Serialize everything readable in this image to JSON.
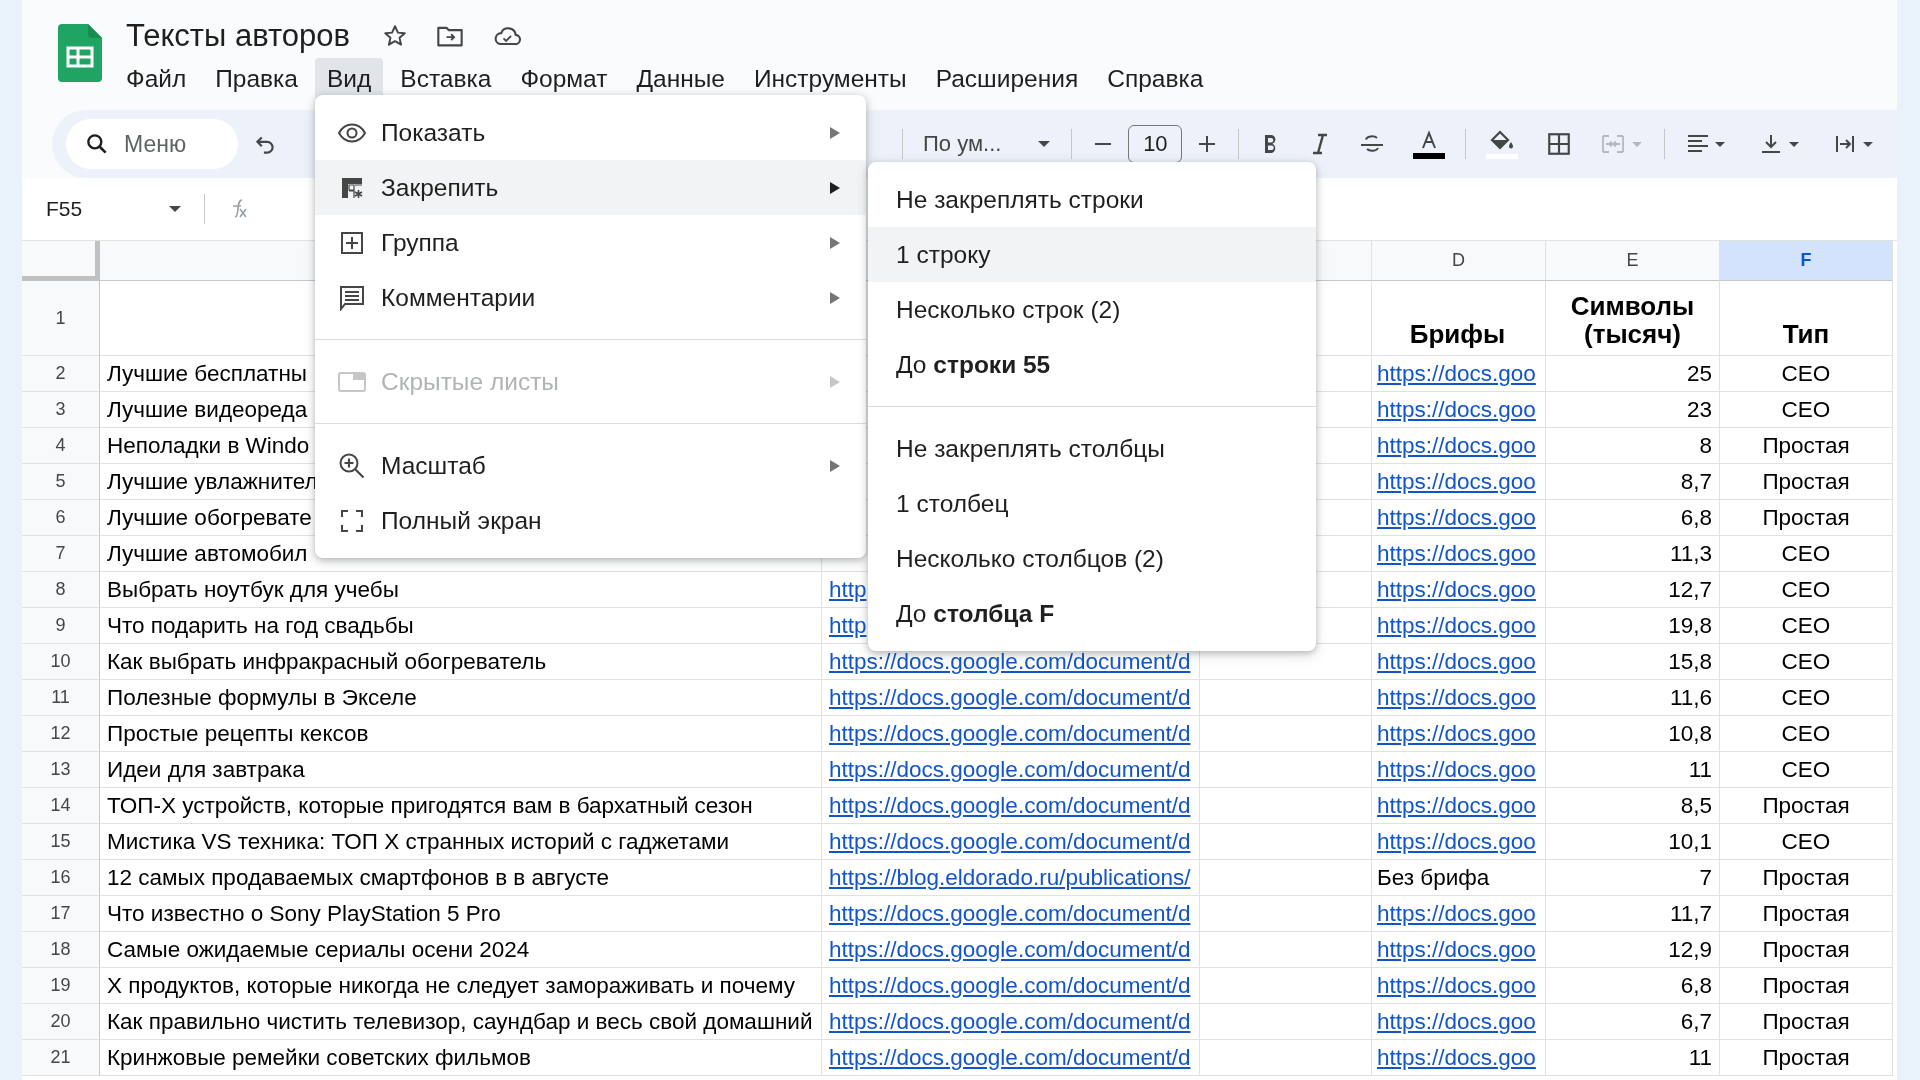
{
  "document": {
    "title": "Тексты авторов"
  },
  "menu_bar": [
    {
      "label": "Файл",
      "selected": false
    },
    {
      "label": "Правка",
      "selected": false
    },
    {
      "label": "Вид",
      "selected": true
    },
    {
      "label": "Вставка",
      "selected": false
    },
    {
      "label": "Формат",
      "selected": false
    },
    {
      "label": "Данные",
      "selected": false
    },
    {
      "label": "Инструменты",
      "selected": false
    },
    {
      "label": "Расширения",
      "selected": false
    },
    {
      "label": "Справка",
      "selected": false
    }
  ],
  "toolbar": {
    "search": {
      "placeholder": "Меню"
    },
    "font": "По ум...",
    "font_size": "10"
  },
  "formula_bar": {
    "cell_ref": "F55"
  },
  "columns": [
    {},
    {},
    {},
    {
      "label": "D",
      "selected": false
    },
    {
      "label": "E",
      "selected": false
    },
    {
      "label": "F",
      "selected": true
    }
  ],
  "rows": [
    {
      "number": "1",
      "cells": [
        {
          "kind": "empty"
        },
        {
          "kind": "empty"
        },
        {
          "kind": "empty"
        },
        {
          "kind": "header",
          "text": "Брифы"
        },
        {
          "kind": "header",
          "text": "Символы (тысяч)"
        },
        {
          "kind": "header",
          "text": "Тип"
        }
      ]
    },
    {
      "number": "2",
      "cells": [
        {
          "kind": "text",
          "text": "Лучшие бесплатны"
        },
        {
          "kind": "empty"
        },
        {
          "kind": "empty"
        },
        {
          "kind": "link",
          "text": "https://docs.goo"
        },
        {
          "kind": "text",
          "text": "25"
        },
        {
          "kind": "text",
          "text": "СЕО"
        }
      ]
    },
    {
      "number": "3",
      "cells": [
        {
          "kind": "text",
          "text": "Лучшие видеореда"
        },
        {
          "kind": "empty"
        },
        {
          "kind": "empty"
        },
        {
          "kind": "link",
          "text": "https://docs.goo"
        },
        {
          "kind": "text",
          "text": "23"
        },
        {
          "kind": "text",
          "text": "СЕО"
        }
      ]
    },
    {
      "number": "4",
      "cells": [
        {
          "kind": "text",
          "text": "Неполадки в Windo"
        },
        {
          "kind": "empty"
        },
        {
          "kind": "empty"
        },
        {
          "kind": "link",
          "text": "https://docs.goo"
        },
        {
          "kind": "text",
          "text": "8"
        },
        {
          "kind": "text",
          "text": "Простая"
        }
      ]
    },
    {
      "number": "5",
      "cells": [
        {
          "kind": "text",
          "text": "Лучшие увлажнител"
        },
        {
          "kind": "empty"
        },
        {
          "kind": "empty"
        },
        {
          "kind": "link",
          "text": "https://docs.goo"
        },
        {
          "kind": "text",
          "text": "8,7"
        },
        {
          "kind": "text",
          "text": "Простая"
        }
      ]
    },
    {
      "number": "6",
      "cells": [
        {
          "kind": "text",
          "text": "Лучшие обогревате"
        },
        {
          "kind": "empty"
        },
        {
          "kind": "empty"
        },
        {
          "kind": "link",
          "text": "https://docs.goo"
        },
        {
          "kind": "text",
          "text": "6,8"
        },
        {
          "kind": "text",
          "text": "Простая"
        }
      ]
    },
    {
      "number": "7",
      "cells": [
        {
          "kind": "text",
          "text": "Лучшие автомобил"
        },
        {
          "kind": "empty"
        },
        {
          "kind": "empty"
        },
        {
          "kind": "link",
          "text": "https://docs.goo"
        },
        {
          "kind": "text",
          "text": "11,3"
        },
        {
          "kind": "text",
          "text": "СЕО"
        }
      ]
    },
    {
      "number": "8",
      "cells": [
        {
          "kind": "text",
          "text": "Выбрать ноутбук для учебы"
        },
        {
          "kind": "link",
          "text": "http"
        },
        {
          "kind": "empty"
        },
        {
          "kind": "link",
          "text": "https://docs.goo"
        },
        {
          "kind": "text",
          "text": "12,7"
        },
        {
          "kind": "text",
          "text": "СЕО"
        }
      ]
    },
    {
      "number": "9",
      "cells": [
        {
          "kind": "text",
          "text": "Что подарить на год свадьбы"
        },
        {
          "kind": "link",
          "text": "http"
        },
        {
          "kind": "empty"
        },
        {
          "kind": "link",
          "text": "https://docs.goo"
        },
        {
          "kind": "text",
          "text": "19,8"
        },
        {
          "kind": "text",
          "text": "СЕО"
        }
      ]
    },
    {
      "number": "10",
      "cells": [
        {
          "kind": "text",
          "text": "Как выбрать инфракрасный обогреватель"
        },
        {
          "kind": "link",
          "text": "https://docs.google.com/document/d"
        },
        {
          "kind": "empty"
        },
        {
          "kind": "link",
          "text": "https://docs.goo"
        },
        {
          "kind": "text",
          "text": "15,8"
        },
        {
          "kind": "text",
          "text": "СЕО"
        }
      ]
    },
    {
      "number": "11",
      "cells": [
        {
          "kind": "text",
          "text": "Полезные формулы в Экселе"
        },
        {
          "kind": "link",
          "text": "https://docs.google.com/document/d"
        },
        {
          "kind": "empty"
        },
        {
          "kind": "link",
          "text": "https://docs.goo"
        },
        {
          "kind": "text",
          "text": "11,6"
        },
        {
          "kind": "text",
          "text": "СЕО"
        }
      ]
    },
    {
      "number": "12",
      "cells": [
        {
          "kind": "text",
          "text": "Простые рецепты кексов"
        },
        {
          "kind": "link",
          "text": "https://docs.google.com/document/d"
        },
        {
          "kind": "empty"
        },
        {
          "kind": "link",
          "text": "https://docs.goo"
        },
        {
          "kind": "text",
          "text": "10,8"
        },
        {
          "kind": "text",
          "text": "СЕО"
        }
      ]
    },
    {
      "number": "13",
      "cells": [
        {
          "kind": "text",
          "text": "Идеи для завтрака"
        },
        {
          "kind": "link",
          "text": "https://docs.google.com/document/d"
        },
        {
          "kind": "empty"
        },
        {
          "kind": "link",
          "text": "https://docs.goo"
        },
        {
          "kind": "text",
          "text": "11"
        },
        {
          "kind": "text",
          "text": "СЕО"
        }
      ]
    },
    {
      "number": "14",
      "cells": [
        {
          "kind": "text",
          "text": "ТОП-Х устройств, которые пригодятся вам в бархатный сезон"
        },
        {
          "kind": "link",
          "text": "https://docs.google.com/document/d"
        },
        {
          "kind": "empty"
        },
        {
          "kind": "link",
          "text": "https://docs.goo"
        },
        {
          "kind": "text",
          "text": "8,5"
        },
        {
          "kind": "text",
          "text": "Простая"
        }
      ]
    },
    {
      "number": "15",
      "cells": [
        {
          "kind": "text",
          "text": "Мистика VS техника: ТОП Х странных историй с гаджетами"
        },
        {
          "kind": "link",
          "text": "https://docs.google.com/document/d"
        },
        {
          "kind": "empty"
        },
        {
          "kind": "link",
          "text": "https://docs.goo"
        },
        {
          "kind": "text",
          "text": "10,1"
        },
        {
          "kind": "text",
          "text": "СЕО"
        }
      ]
    },
    {
      "number": "16",
      "cells": [
        {
          "kind": "text",
          "text": "12 самых продаваемых смартфонов в в августе"
        },
        {
          "kind": "link",
          "text": "https://blog.eldorado.ru/publications/"
        },
        {
          "kind": "empty"
        },
        {
          "kind": "text",
          "text": "Без брифа"
        },
        {
          "kind": "text",
          "text": "7"
        },
        {
          "kind": "text",
          "text": "Простая"
        }
      ]
    },
    {
      "number": "17",
      "cells": [
        {
          "kind": "text",
          "text": "Что известно о Sony PlayStation 5 Pro"
        },
        {
          "kind": "link",
          "text": "https://docs.google.com/document/d"
        },
        {
          "kind": "empty"
        },
        {
          "kind": "link",
          "text": "https://docs.goo"
        },
        {
          "kind": "text",
          "text": "11,7"
        },
        {
          "kind": "text",
          "text": "Простая"
        }
      ]
    },
    {
      "number": "18",
      "cells": [
        {
          "kind": "text",
          "text": "Самые ожидаемые сериалы осени 2024"
        },
        {
          "kind": "link",
          "text": "https://docs.google.com/document/d"
        },
        {
          "kind": "empty"
        },
        {
          "kind": "link",
          "text": "https://docs.goo"
        },
        {
          "kind": "text",
          "text": "12,9"
        },
        {
          "kind": "text",
          "text": "Простая"
        }
      ]
    },
    {
      "number": "19",
      "cells": [
        {
          "kind": "text",
          "text": "Х продуктов, которые никогда не следует замораживать и почему"
        },
        {
          "kind": "link",
          "text": "https://docs.google.com/document/d"
        },
        {
          "kind": "empty"
        },
        {
          "kind": "link",
          "text": "https://docs.goo"
        },
        {
          "kind": "text",
          "text": "6,8"
        },
        {
          "kind": "text",
          "text": "Простая"
        }
      ]
    },
    {
      "number": "20",
      "cells": [
        {
          "kind": "text",
          "text": "Как правильно чистить телевизор, саундбар и весь свой домашний"
        },
        {
          "kind": "link",
          "text": "https://docs.google.com/document/d"
        },
        {
          "kind": "empty"
        },
        {
          "kind": "link",
          "text": "https://docs.goo"
        },
        {
          "kind": "text",
          "text": "6,7"
        },
        {
          "kind": "text",
          "text": "Простая"
        }
      ]
    },
    {
      "number": "21",
      "cells": [
        {
          "kind": "text",
          "text": "Кринжовые ремейки советских фильмов"
        },
        {
          "kind": "link",
          "text": "https://docs.google.com/document/d"
        },
        {
          "kind": "empty"
        },
        {
          "kind": "link",
          "text": "https://docs.goo"
        },
        {
          "kind": "text",
          "text": "11"
        },
        {
          "kind": "text",
          "text": "Простая"
        }
      ]
    }
  ],
  "view_menu": {
    "items": [
      {
        "kind": "item",
        "label": "Показать",
        "selected": false,
        "disabled": false,
        "submenu": true
      },
      {
        "kind": "item",
        "label": "Закрепить",
        "selected": true,
        "disabled": false,
        "submenu": true
      },
      {
        "kind": "item",
        "label": "Группа",
        "selected": false,
        "disabled": false,
        "submenu": true
      },
      {
        "kind": "item",
        "label": "Комментарии",
        "selected": false,
        "disabled": false,
        "submenu": true
      },
      {
        "kind": "divider"
      },
      {
        "kind": "item",
        "label": "Скрытые листы",
        "selected": false,
        "disabled": true,
        "submenu": true
      },
      {
        "kind": "divider"
      },
      {
        "kind": "item",
        "label": "Масштаб",
        "selected": false,
        "disabled": false,
        "submenu": true
      },
      {
        "kind": "item",
        "label": "Полный экран",
        "selected": false,
        "disabled": false,
        "submenu": false
      }
    ]
  },
  "freeze_submenu": {
    "items": [
      {
        "kind": "item",
        "label": "Не закреплять строки",
        "selected": false
      },
      {
        "kind": "item",
        "label": "1 строку",
        "selected": true
      },
      {
        "kind": "item",
        "label": "Несколько строк (2)",
        "selected": false
      },
      {
        "kind": "item",
        "label": "До **строки 55**",
        "selected": false
      },
      {
        "kind": "divider"
      },
      {
        "kind": "item",
        "label": "Не закреплять столбцы",
        "selected": false
      },
      {
        "kind": "item",
        "label": "1 столбец",
        "selected": false
      },
      {
        "kind": "item",
        "label": "Несколько столбцов (2)",
        "selected": false
      },
      {
        "kind": "item",
        "label": "До **столбца F**",
        "selected": false
      }
    ]
  }
}
